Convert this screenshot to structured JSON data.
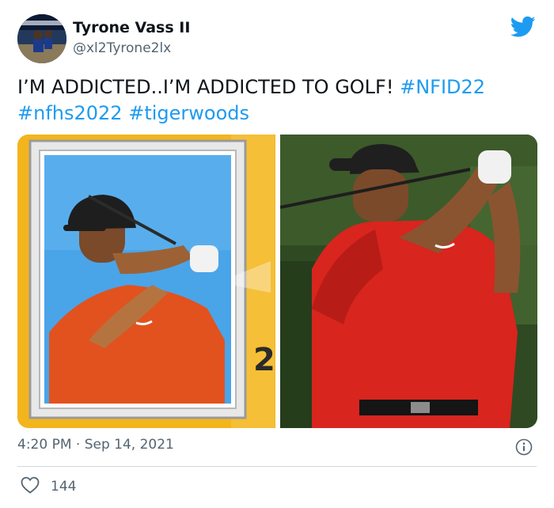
{
  "author": {
    "display_name": "Tyrone Vass II",
    "handle": "@xl2Tyrone2lx"
  },
  "tweet": {
    "text_plain": "I’M ADDICTED..I’M ADDICTED TO GOLF! ",
    "hashtags": [
      "#NFID22",
      "#nfhs2022",
      "#tigerwoods"
    ]
  },
  "media": {
    "left_card_number": "2"
  },
  "meta": {
    "timestamp": "4:20 PM · Sep 14, 2021",
    "like_count": "144"
  },
  "icons": {
    "brand": "twitter-bird-icon",
    "info": "info-icon",
    "like": "heart-icon"
  },
  "colors": {
    "accent": "#1d9bf0",
    "secondary_text": "#536471",
    "divider": "#cfd9de"
  }
}
